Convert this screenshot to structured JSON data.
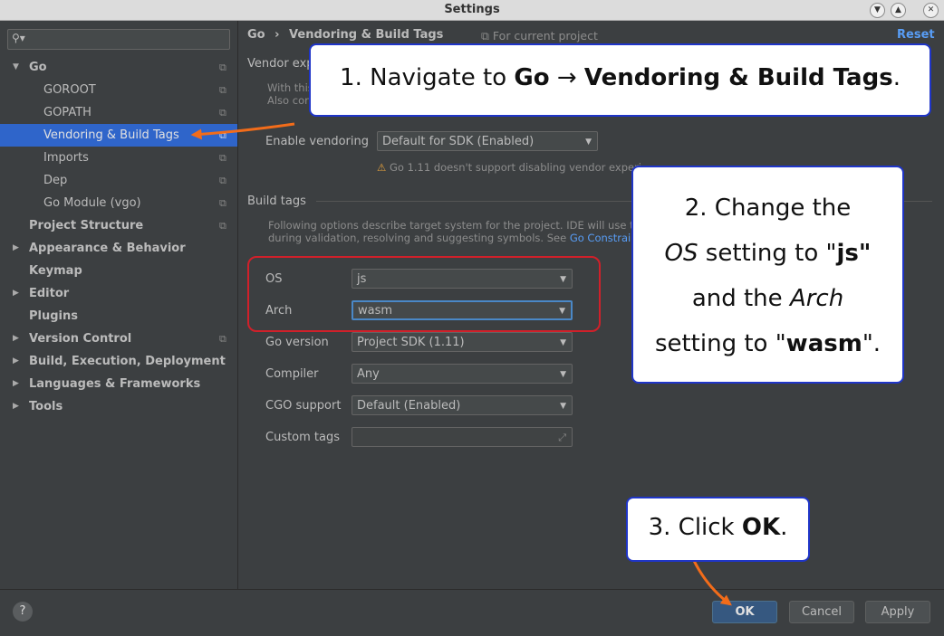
{
  "window": {
    "title": "Settings"
  },
  "search": {
    "placeholder": ""
  },
  "sidebar": {
    "items": [
      {
        "label": "Go",
        "expanded": true
      },
      {
        "label": "GOROOT"
      },
      {
        "label": "GOPATH"
      },
      {
        "label": "Vendoring & Build Tags"
      },
      {
        "label": "Imports"
      },
      {
        "label": "Dep"
      },
      {
        "label": "Go Module (vgo)"
      },
      {
        "label": "Project Structure"
      },
      {
        "label": "Appearance & Behavior"
      },
      {
        "label": "Keymap"
      },
      {
        "label": "Editor"
      },
      {
        "label": "Plugins"
      },
      {
        "label": "Version Control"
      },
      {
        "label": "Build, Execution, Deployment"
      },
      {
        "label": "Languages & Frameworks"
      },
      {
        "label": "Tools"
      }
    ]
  },
  "header": {
    "crumb_go": "Go",
    "crumb_sep": "›",
    "crumb_page": "Vendoring & Build Tags",
    "scope": "For current project",
    "reset": "Reset"
  },
  "vendor": {
    "section": "Vendor exp",
    "desc1": "With this",
    "desc2": "Also cor",
    "enable_label": "Enable vendoring",
    "enable_value": "Default for SDK (Enabled)",
    "warning": "Go 1.11 doesn't support disabling vendor experi"
  },
  "build": {
    "section": "Build tags",
    "desc1": "Following options describe target system for the project. IDE will use t",
    "desc2": "during validation, resolving and suggesting symbols. See",
    "link": "Go Constrai",
    "os_label": "OS",
    "os_value": "js",
    "arch_label": "Arch",
    "arch_value": "wasm",
    "goversion_label": "Go version",
    "goversion_value": "Project SDK (1.11)",
    "compiler_label": "Compiler",
    "compiler_value": "Any",
    "cgo_label": "CGO support",
    "cgo_value": "Default (Enabled)",
    "custom_label": "Custom tags",
    "custom_value": ""
  },
  "buttons": {
    "ok": "OK",
    "cancel": "Cancel",
    "apply": "Apply",
    "help": "?"
  },
  "callouts": {
    "c1_prefix": "1. Navigate to ",
    "c1_go": "Go",
    "c1_arrow": " → ",
    "c1_page": "Vendoring & Build Tags",
    "c1_end": ".",
    "c2_line1": "2. Change the",
    "c2_os": "OS",
    "c2_mid": " setting to \"",
    "c2_js": "js",
    "c2_q": "\"",
    "c2_and": "and the ",
    "c2_arch": "Arch",
    "c2_setting": "setting to \"",
    "c2_wasm": "wasm",
    "c2_end": "\".",
    "c3_prefix": "3. Click ",
    "c3_ok": "OK",
    "c3_end": "."
  },
  "colors": {
    "accent": "#2f65ca",
    "annotation": "#f26c1a",
    "callout_border": "#1f35c8",
    "highlight": "#d0202a"
  }
}
